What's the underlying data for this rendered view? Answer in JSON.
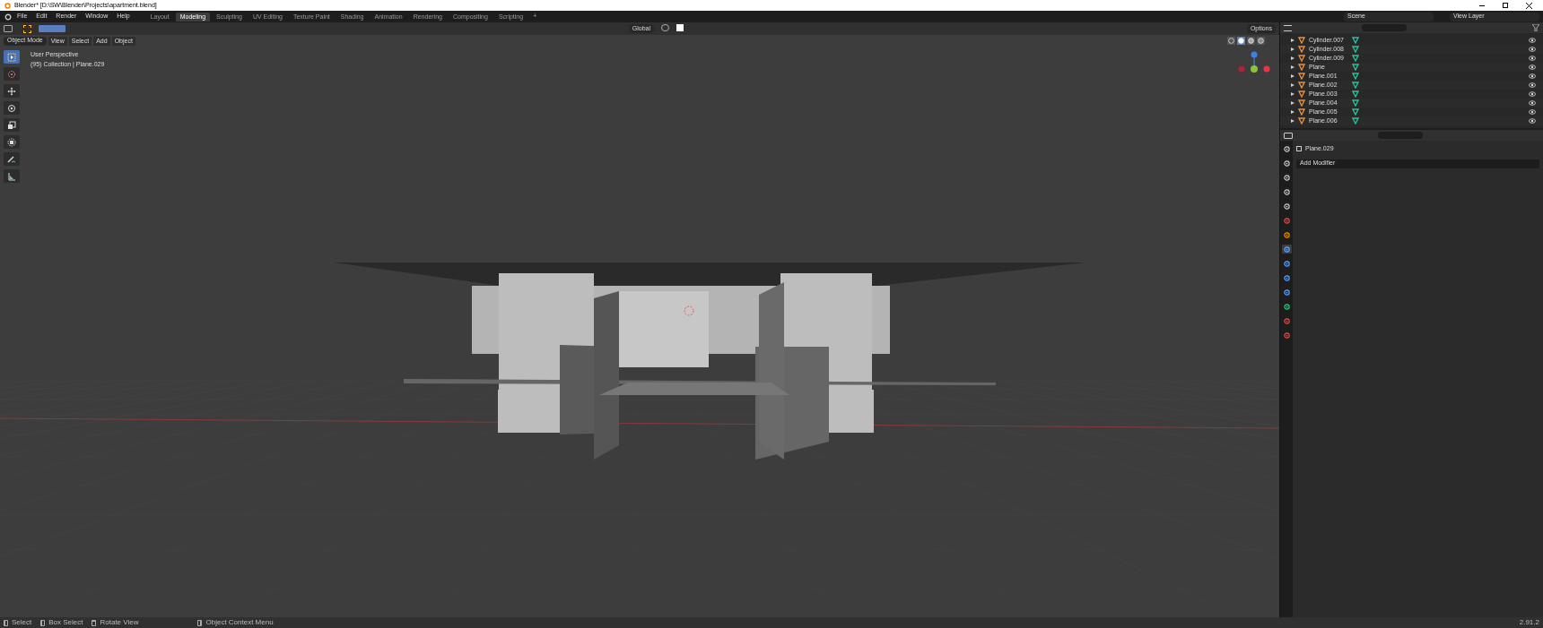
{
  "window": {
    "title": "Blender* [D:\\SW\\Blender\\Projects\\apartment.blend]"
  },
  "menu": [
    "File",
    "Edit",
    "Render",
    "Window",
    "Help"
  ],
  "workspaces": [
    {
      "label": "Layout",
      "selected": false
    },
    {
      "label": "Modeling",
      "selected": true
    },
    {
      "label": "Sculpting",
      "selected": false
    },
    {
      "label": "UV Editing",
      "selected": false
    },
    {
      "label": "Texture Paint",
      "selected": false
    },
    {
      "label": "Shading",
      "selected": false
    },
    {
      "label": "Animation",
      "selected": false
    },
    {
      "label": "Rendering",
      "selected": false
    },
    {
      "label": "Compositing",
      "selected": false
    },
    {
      "label": "Scripting",
      "selected": false
    }
  ],
  "add_workspace": "+",
  "scene": "Scene",
  "view_layer": "View Layer",
  "tool_header": {
    "orientation": "Global",
    "options": "Options"
  },
  "viewport_header": {
    "mode": "Object Mode",
    "menus": [
      "View",
      "Select",
      "Add",
      "Object"
    ],
    "shading": [
      {
        "kind": "wire",
        "selected": false
      },
      {
        "kind": "solid",
        "selected": true
      },
      {
        "kind": "material",
        "selected": false
      },
      {
        "kind": "rendered",
        "selected": false
      }
    ]
  },
  "viewport": {
    "view_name": "User Perspective",
    "collection": "(95) Collection | Plane.029"
  },
  "tools": [
    {
      "kind": "select",
      "selected": true
    },
    {
      "kind": "cursor",
      "selected": false
    },
    {
      "kind": "move",
      "selected": false
    },
    {
      "kind": "rotate",
      "selected": false
    },
    {
      "kind": "scale",
      "selected": false
    },
    {
      "kind": "transform",
      "selected": false
    },
    {
      "kind": "annotate",
      "selected": false
    },
    {
      "kind": "measure",
      "selected": false
    }
  ],
  "outliner": {
    "items": [
      {
        "name": "Cylinder.007",
        "visible": true
      },
      {
        "name": "Cylinder.008",
        "visible": true
      },
      {
        "name": "Cylinder.009",
        "visible": true
      },
      {
        "name": "Plane",
        "visible": true
      },
      {
        "name": "Plane.001",
        "visible": true
      },
      {
        "name": "Plane.002",
        "visible": true
      },
      {
        "name": "Plane.003",
        "visible": true
      },
      {
        "name": "Plane.004",
        "visible": true
      },
      {
        "name": "Plane.005",
        "visible": true
      },
      {
        "name": "Plane.006",
        "visible": true
      }
    ]
  },
  "properties": {
    "object": "Plane.029",
    "add_modifier": "Add Modifier",
    "tabs": [
      {
        "kind": "tool",
        "selected": false
      },
      {
        "kind": "render",
        "selected": false
      },
      {
        "kind": "output",
        "selected": false
      },
      {
        "kind": "view-layer",
        "selected": false
      },
      {
        "kind": "scene",
        "selected": false
      },
      {
        "kind": "world",
        "selected": false
      },
      {
        "kind": "object",
        "selected": false
      },
      {
        "kind": "modifiers",
        "selected": true
      },
      {
        "kind": "particles",
        "selected": false
      },
      {
        "kind": "physics",
        "selected": false
      },
      {
        "kind": "constraints",
        "selected": false
      },
      {
        "kind": "data",
        "selected": false
      },
      {
        "kind": "material",
        "selected": false
      },
      {
        "kind": "texture",
        "selected": false
      }
    ]
  },
  "status_bar": {
    "items": [
      {
        "kind": "left",
        "label": "Select"
      },
      {
        "kind": "left",
        "label": "Box Select"
      },
      {
        "kind": "middle",
        "label": "Rotate View"
      },
      {
        "kind": "right",
        "label": "Object Context Menu"
      }
    ],
    "version": "2.91.2"
  }
}
